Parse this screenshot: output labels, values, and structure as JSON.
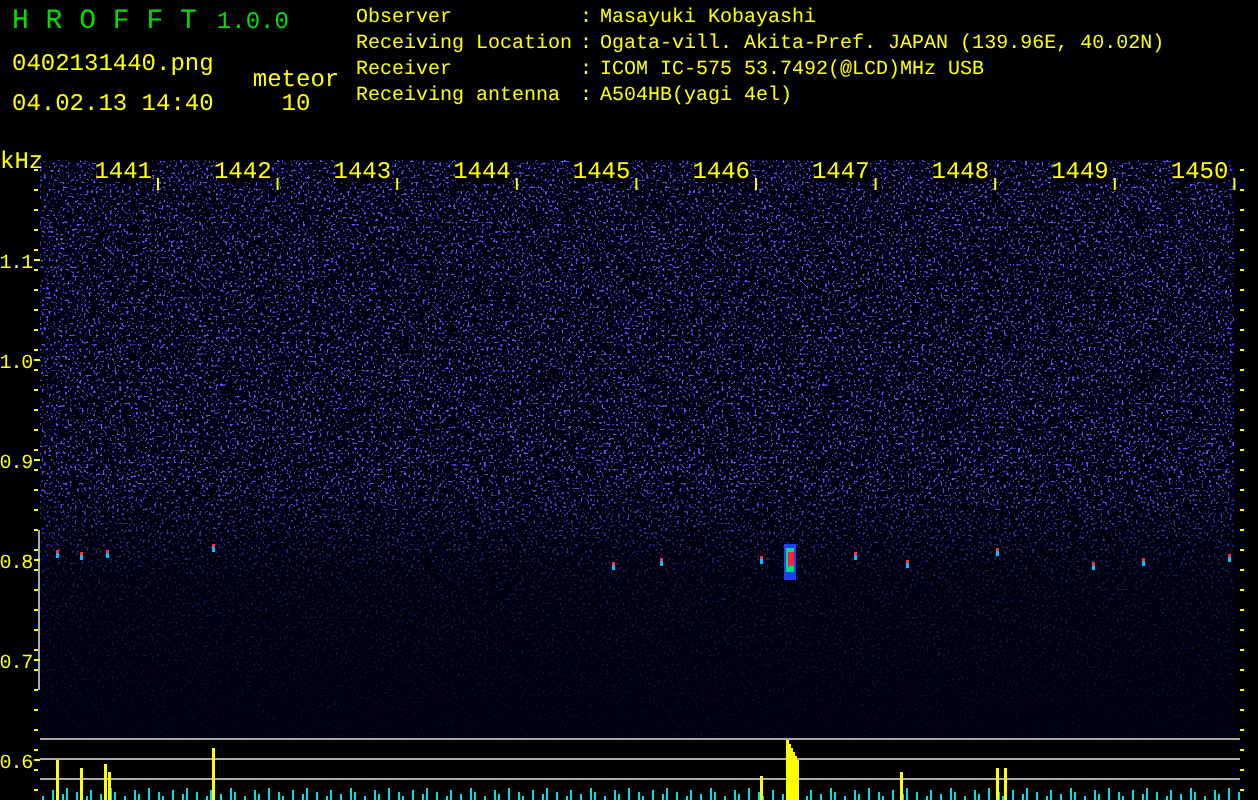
{
  "header": {
    "app_name": "H R O F F T",
    "version": "1.0.0",
    "file_name": "0402131440.png",
    "timestamp": "04.02.13 14:40",
    "count_label": "meteor",
    "count_value": "10"
  },
  "info": [
    {
      "label": "Observer",
      "separator": ":",
      "value": "Masayuki Kobayashi"
    },
    {
      "label": "Receiving Location",
      "separator": ":",
      "value": "Ogata-vill. Akita-Pref. JAPAN (139.96E, 40.02N)"
    },
    {
      "label": "Receiver",
      "separator": ":",
      "value": "ICOM IC-575 53.7492(@LCD)MHz USB"
    },
    {
      "label": "Receiving antenna",
      "separator": ":",
      "value": "A504HB(yagi 4el)"
    }
  ],
  "spectrogram": {
    "y_unit": "kHz",
    "x_ticks": [
      "1441",
      "1442",
      "1443",
      "1444",
      "1445",
      "1446",
      "1447",
      "1448",
      "1449",
      "1450"
    ],
    "y_ticks": [
      "1.1",
      "1.0",
      "0.9",
      "0.8",
      "0.7",
      "0.6"
    ]
  }
}
